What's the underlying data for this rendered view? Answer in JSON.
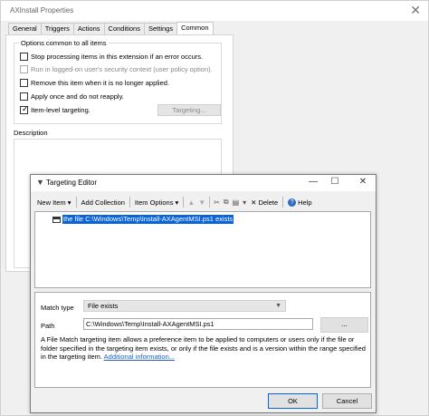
{
  "props_window": {
    "title": "AXInstall Properties",
    "tabs": [
      "General",
      "Triggers",
      "Actions",
      "Conditions",
      "Settings",
      "Common"
    ],
    "active_tab": "Common",
    "options_legend": "Options common to all items",
    "options": [
      {
        "label": "Stop processing items in this extension if an error occurs.",
        "checked": false,
        "disabled": false
      },
      {
        "label": "Run in logged-on user's security context (user policy option).",
        "checked": false,
        "disabled": true
      },
      {
        "label": "Remove this item when it is no longer applied.",
        "checked": false,
        "disabled": false
      },
      {
        "label": "Apply once and do not reapply.",
        "checked": false,
        "disabled": false
      },
      {
        "label": "Item-level targeting.",
        "checked": true,
        "disabled": false
      }
    ],
    "targeting_button": "Targeting...",
    "description_label": "Description"
  },
  "editor": {
    "title": "Targeting Editor",
    "toolbar": {
      "new_item": "New Item",
      "add_collection": "Add Collection",
      "item_options": "Item Options",
      "delete": "Delete",
      "help": "Help"
    },
    "tree_item": "the file C:\\Windows\\Temp\\Install-AXAgentMSI.ps1 exists",
    "match_type_label": "Match type",
    "match_type_value": "File exists",
    "path_label": "Path",
    "path_value": "C:\\Windows\\Temp\\Install-AXAgentMSI.ps1",
    "browse_button": "...",
    "help_text": "A File Match targeting item allows a preference item to be applied to computers or users only if the file or folder specified in the targeting item exists, or only if the file exists and is a version within the range specified in the targeting item.",
    "help_link": "Additional information...",
    "ok_button": "OK",
    "cancel_button": "Cancel"
  }
}
